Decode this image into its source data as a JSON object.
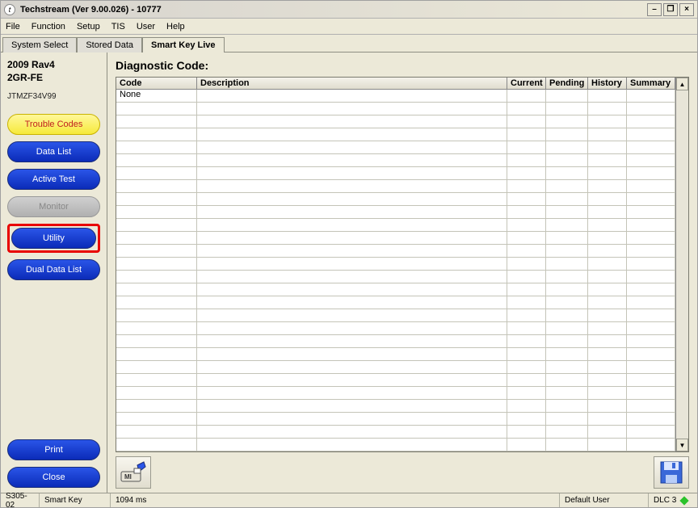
{
  "window": {
    "title": "Techstream (Ver 9.00.026) - 10777",
    "app_icon_char": "t"
  },
  "menubar": [
    "File",
    "Function",
    "Setup",
    "TIS",
    "User",
    "Help"
  ],
  "tabs": [
    {
      "label": "System Select",
      "active": false
    },
    {
      "label": "Stored Data",
      "active": false
    },
    {
      "label": "Smart Key Live",
      "active": true
    }
  ],
  "vehicle": {
    "line1": "2009 Rav4",
    "line2": "2GR-FE",
    "vin": "JTMZF34V99"
  },
  "sidebar_buttons": {
    "trouble_codes": "Trouble Codes",
    "data_list": "Data List",
    "active_test": "Active Test",
    "monitor": "Monitor",
    "utility": "Utility",
    "dual_data_list": "Dual Data List",
    "print": "Print",
    "close": "Close"
  },
  "main": {
    "heading": "Diagnostic Code:",
    "columns": {
      "code": "Code",
      "description": "Description",
      "current": "Current",
      "pending": "Pending",
      "history": "History",
      "summary": "Summary"
    },
    "rows": [
      {
        "code": "None",
        "description": "",
        "current": "",
        "pending": "",
        "history": "",
        "summary": ""
      }
    ],
    "empty_row_count": 27
  },
  "statusbar": {
    "code": "S305-02",
    "system": "Smart Key",
    "time": "1094 ms",
    "user": "Default User",
    "conn": "DLC 3"
  }
}
